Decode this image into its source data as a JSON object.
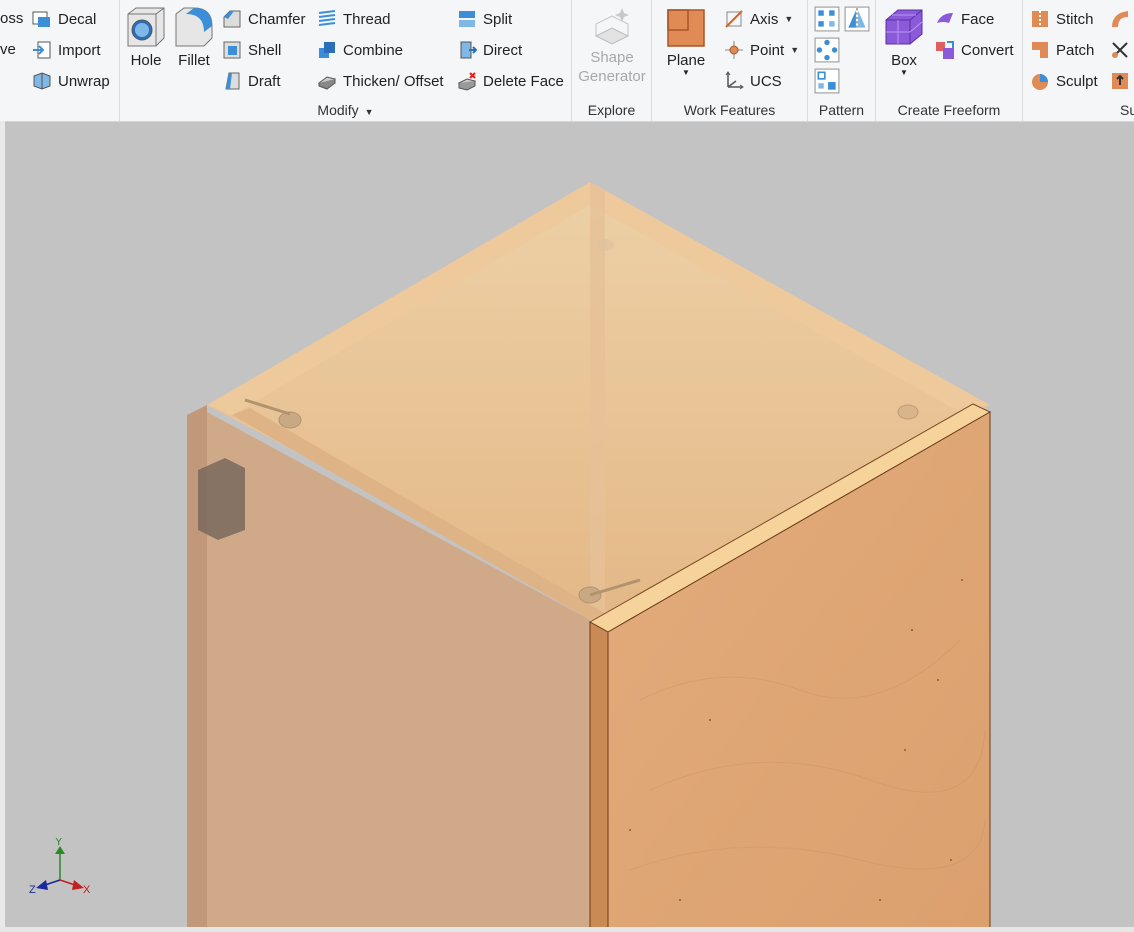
{
  "ribbon": {
    "cut_left": {
      "oss": "oss",
      "ve": "ve"
    },
    "create_extra": {
      "decal": "Decal",
      "import": "Import",
      "unwrap": "Unwrap"
    },
    "modify": {
      "title": "Modify",
      "hole": "Hole",
      "fillet": "Fillet",
      "chamfer": "Chamfer",
      "shell": "Shell",
      "draft": "Draft",
      "thread": "Thread",
      "combine": "Combine",
      "thicken": "Thicken/ Offset",
      "split": "Split",
      "direct": "Direct",
      "delete_face": "Delete Face"
    },
    "explore": {
      "title": "Explore",
      "shape_line1": "Shape",
      "shape_line2": "Generator"
    },
    "work_features": {
      "title": "Work Features",
      "plane": "Plane",
      "axis": "Axis",
      "point": "Point",
      "ucs": "UCS"
    },
    "pattern": {
      "title": "Pattern"
    },
    "freeform": {
      "title": "Create Freeform",
      "box": "Box",
      "face": "Face",
      "convert": "Convert"
    },
    "surface": {
      "title_cut": "Su",
      "stitch": "Stitch",
      "patch": "Patch",
      "sculpt": "Sculpt"
    }
  },
  "viewcube": {
    "y": "Y",
    "z": "Z",
    "x": "X"
  },
  "colors": {
    "accent_blue": "#3b8fd8",
    "orange": "#e08a55",
    "purple": "#8a5ad8",
    "model_wood": "#e0a676",
    "background": "#c3c3c3"
  }
}
